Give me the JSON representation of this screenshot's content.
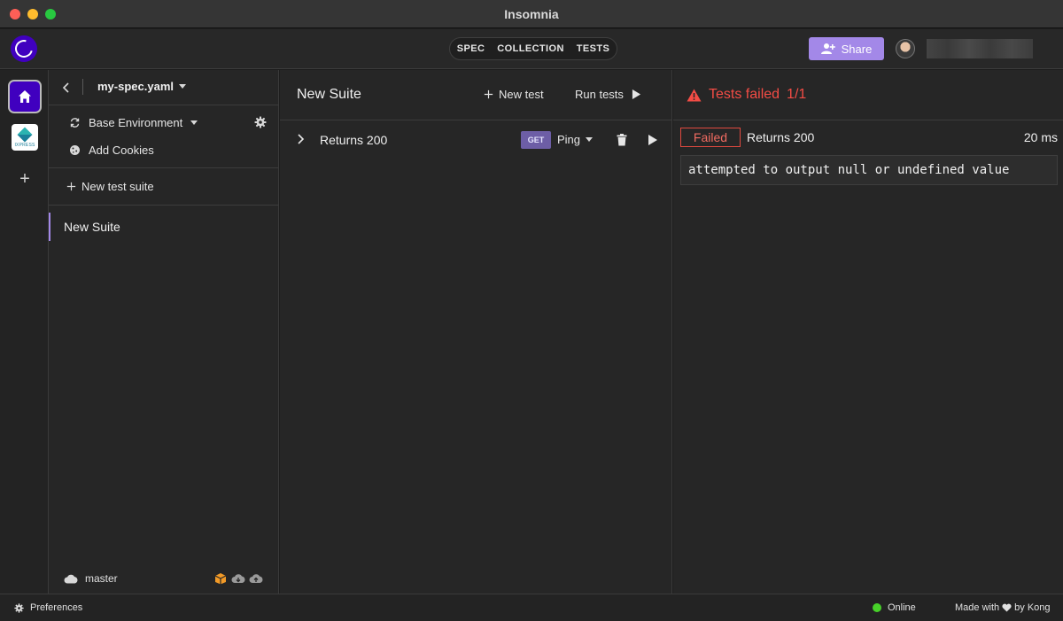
{
  "window": {
    "title": "Insomnia"
  },
  "header": {
    "tabs": [
      {
        "label": "SPEC"
      },
      {
        "label": "COLLECTION"
      },
      {
        "label": "TESTS"
      }
    ],
    "share_label": "Share"
  },
  "activity_bar": {
    "project_logo_text": "IXPRESS"
  },
  "sidebar": {
    "file_name": "my-spec.yaml",
    "environment_label": "Base Environment",
    "cookies_label": "Add Cookies",
    "new_suite_label": "New test suite",
    "suites": [
      {
        "label": "New Suite"
      }
    ],
    "branch": "master"
  },
  "tests_pane": {
    "title": "New Suite",
    "new_test_label": "New test",
    "run_tests_label": "Run tests",
    "tests": [
      {
        "name": "Returns 200",
        "method": "GET",
        "request": "Ping"
      }
    ]
  },
  "results_pane": {
    "status_text": "Tests failed",
    "count": "1/1",
    "results": [
      {
        "badge": "Failed",
        "name": "Returns 200",
        "time": "20 ms",
        "error": "attempted to output null or undefined value"
      }
    ]
  },
  "statusbar": {
    "preferences_label": "Preferences",
    "online_label": "Online",
    "made_with": "Made with",
    "by": "by Kong"
  },
  "colors": {
    "accent": "#a388e8",
    "brand": "#4000bf",
    "danger": "#f44c45",
    "online": "#47d129",
    "method_get": "#6d5ea6"
  }
}
